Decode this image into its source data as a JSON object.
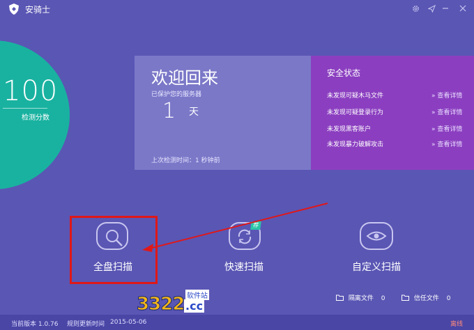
{
  "app": {
    "title": "安骑士"
  },
  "score": {
    "value": "100",
    "label": "检测分数"
  },
  "welcome": {
    "title": "欢迎回来",
    "protect_text": "已保护您的服务器",
    "days": "1",
    "days_unit": "天",
    "last_check": "上次检测时间：1 秒钟前"
  },
  "security": {
    "title": "安全状态",
    "items": [
      {
        "text": "未发现可疑木马文件",
        "link": "» 查看详情"
      },
      {
        "text": "未发现可疑登录行为",
        "link": "» 查看详情"
      },
      {
        "text": "未发现黑客账户",
        "link": "» 查看详情"
      },
      {
        "text": "未发现暴力破解攻击",
        "link": "» 查看详情"
      }
    ]
  },
  "actions": {
    "full_scan": "全盘扫描",
    "quick_scan": "快速扫描",
    "quick_badge": "荐",
    "custom_scan": "自定义扫描"
  },
  "files": {
    "quarantine_label": "隔离文件",
    "quarantine_count": "0",
    "trust_label": "信任文件",
    "trust_count": "0"
  },
  "watermark": {
    "text": "3322",
    "sub": "软件站",
    "domain": ".cc"
  },
  "status": {
    "version_label": "当前版本 1.0.76",
    "rule_label": "规则更新时间",
    "rule_date": "2015-05-06",
    "offline": "离线"
  },
  "colors": {
    "background": "#5a56b4",
    "score": "#19b2a0",
    "welcome_panel": "#7b78c8",
    "security_panel": "#8b3fc0",
    "highlight": "#e01818"
  }
}
